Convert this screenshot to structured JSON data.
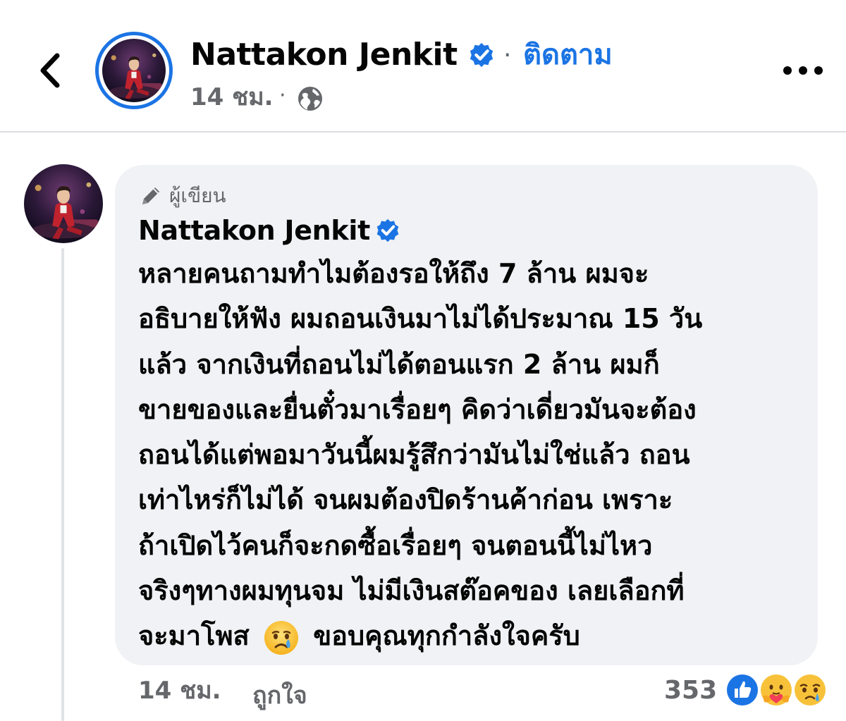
{
  "header": {
    "page_name": "Nattakon Jenkit",
    "separator": "·",
    "follow_label": "ติดตาม",
    "time": "14 ชม.",
    "time_separator": "·",
    "audience_icon": "globe-icon",
    "back_icon": "chevron-left-icon",
    "more_icon": "more-horizontal-icon"
  },
  "comment": {
    "author_badge": "ผู้เขียน",
    "author_badge_icon": "pencil-icon",
    "author_name": "Nattakon Jenkit",
    "verified_icon": "verified-badge-icon",
    "lines": [
      "หลายคนถามทำไมต้องรอให้ถึง 7 ล้าน ผมจะ",
      "อธิบายให้ฟัง ผมถอนเงินมาไม่ได้ประมาณ 15 วัน",
      "แล้ว จากเงินที่ถอนไม่ได้ตอนแรก 2 ล้าน ผมก็",
      "ขายของและยื่นตั๋วมาเรื่อยๆ คิดว่าเดี่ยวมันจะต้อง",
      "ถอนได้แต่พอมาวันนี้ผมรู้สึกว่ามันไม่ใช่แล้ว ถอน",
      "เท่าไหร่ก็ไม่ได้ จนผมต้องปิดร้านค้าก่อน เพราะ",
      "ถ้าเปิดไว้คนก็จะกดซื้อเรื่อยๆ จนตอนนี้ไม่ไหว",
      "จริงๆทางผมทุนจม ไม่มีเงินสต๊อคของ เลยเลือกที่"
    ],
    "last_line_before_emoji": "จะมาโพส",
    "emoji": "crying-face-emoji",
    "last_line_after_emoji": "ขอบคุณทุกกำลังใจครับ"
  },
  "footer": {
    "time": "14 ชม.",
    "like_label": "ถูกใจ",
    "reaction_count": "353",
    "reactions": [
      "like-reaction-icon",
      "care-reaction-icon",
      "sad-reaction-icon"
    ]
  },
  "colors": {
    "accent": "#1b74e4",
    "bubble_bg": "#f0f2f5",
    "secondary_text": "#65676b",
    "primary_text": "#050505"
  }
}
